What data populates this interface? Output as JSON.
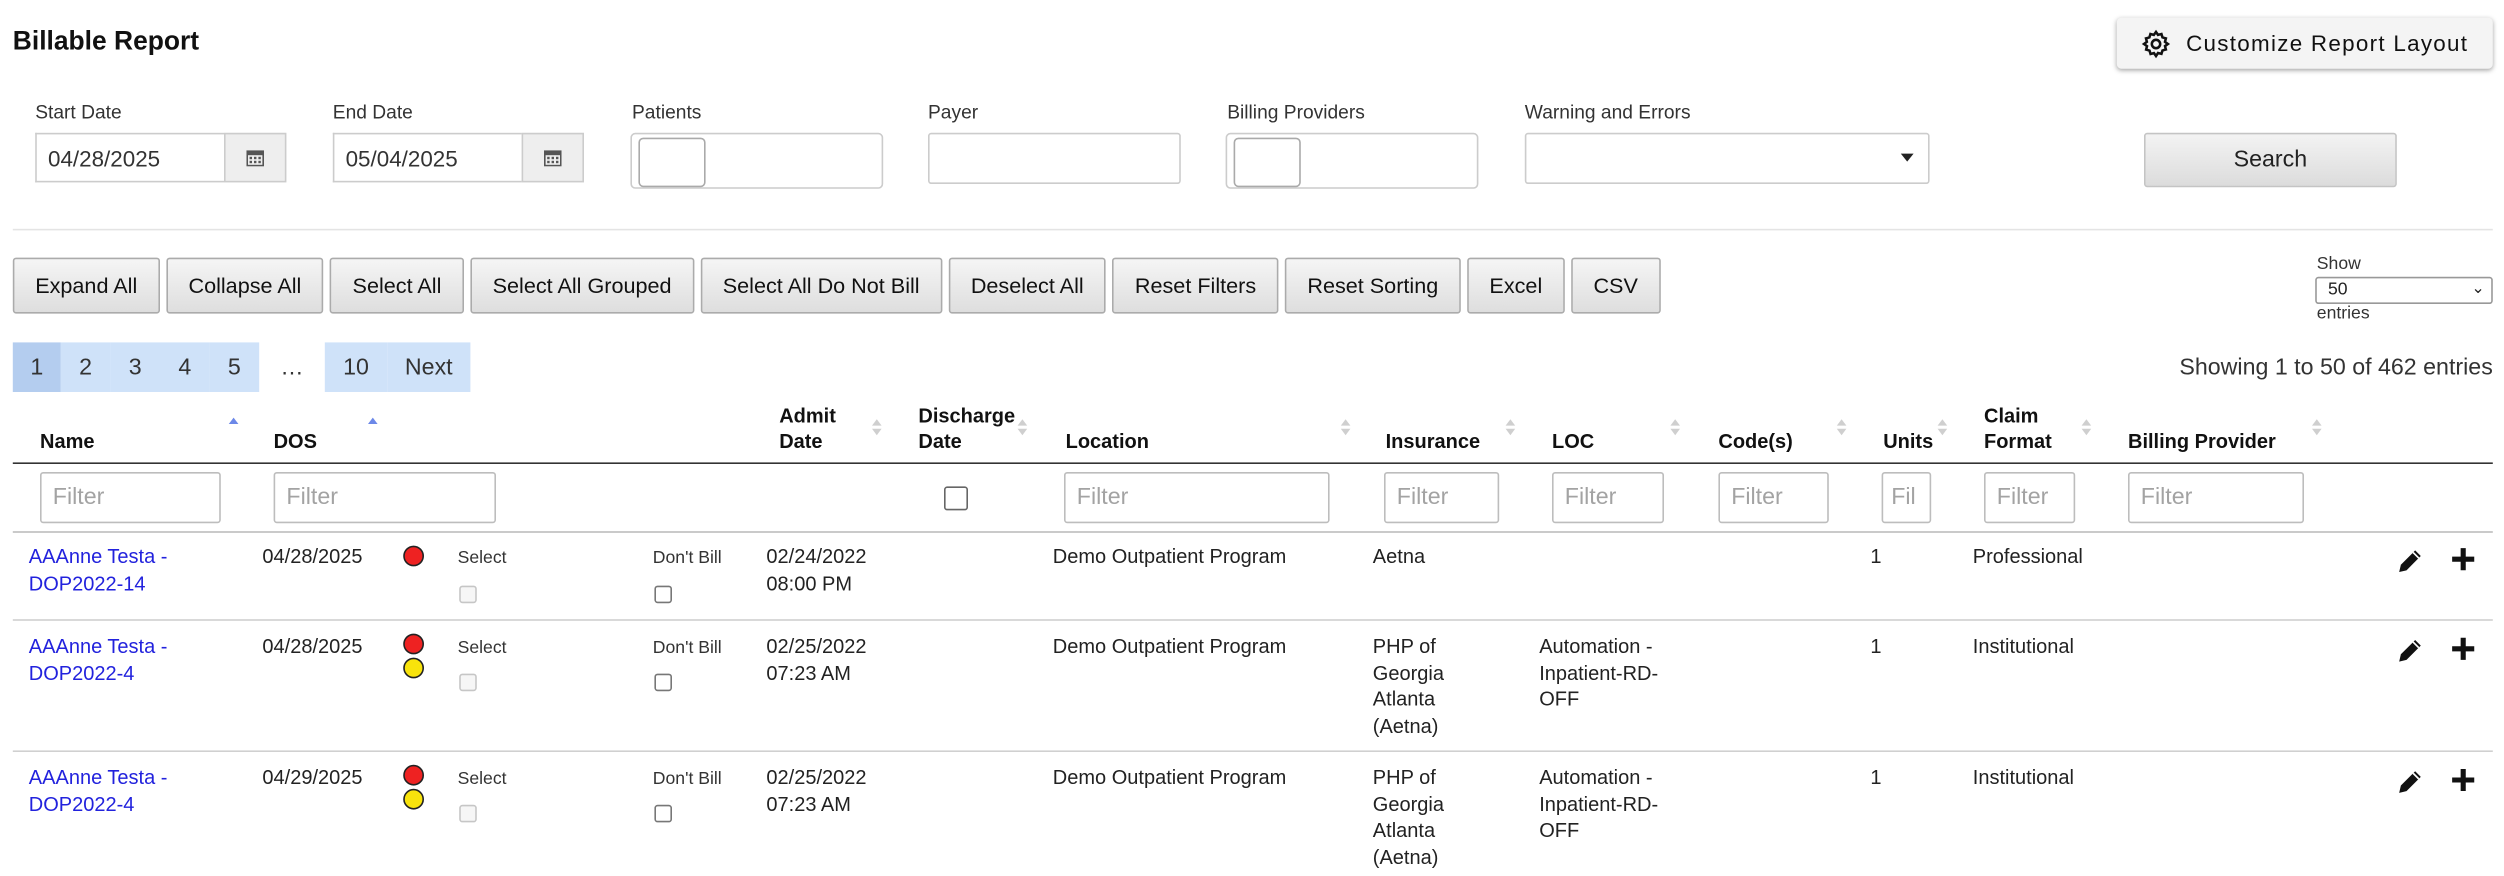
{
  "page": {
    "title": "Billable Report",
    "customize_label": "Customize Report Layout"
  },
  "filters": {
    "start_date": {
      "label": "Start Date",
      "value": "04/28/2025"
    },
    "end_date": {
      "label": "End Date",
      "value": "05/04/2025"
    },
    "patients": {
      "label": "Patients"
    },
    "payer": {
      "label": "Payer"
    },
    "billing_providers": {
      "label": "Billing Providers"
    },
    "warnings": {
      "label": "Warning and Errors"
    },
    "search_label": "Search"
  },
  "toolbar": {
    "expand_all": "Expand All",
    "collapse_all": "Collapse All",
    "select_all": "Select All",
    "select_all_grouped": "Select All Grouped",
    "select_all_dnb": "Select All Do Not Bill",
    "deselect_all": "Deselect All",
    "reset_filters": "Reset Filters",
    "reset_sorting": "Reset Sorting",
    "excel": "Excel",
    "csv": "CSV"
  },
  "page_length": {
    "show": "Show",
    "value": "50",
    "entries": "entries"
  },
  "pagination": {
    "pages": [
      "1",
      "2",
      "3",
      "4",
      "5"
    ],
    "ellipsis": "…",
    "last": "10",
    "next": "Next",
    "current": "1"
  },
  "showing": "Showing 1 to 50 of 462 entries",
  "columns": {
    "name": "Name",
    "dos": "DOS",
    "admit_1": "Admit",
    "admit_2": "Date",
    "discharge_1": "Discharge",
    "discharge_2": "Date",
    "location": "Location",
    "insurance": "Insurance",
    "loc": "LOC",
    "codes": "Code(s)",
    "units": "Units",
    "claim_1": "Claim",
    "claim_2": "Format",
    "billing_provider": "Billing Provider"
  },
  "filter_placeholder": "Filter",
  "filter_placeholder_short": "Fil",
  "row_labels": {
    "select": "Select",
    "dont_bill": "Don't Bill"
  },
  "rows": [
    {
      "name_1": "AAAnne Testa -",
      "name_2": "DOP2022-14",
      "dos": "04/28/2025",
      "status": [
        "red"
      ],
      "admit_1": "02/24/2022",
      "admit_2": "08:00 PM",
      "location": "Demo Outpatient Program",
      "insurance": [
        "Aetna"
      ],
      "loc": [],
      "units": "1",
      "claim_format": "Professional"
    },
    {
      "name_1": "AAAnne Testa -",
      "name_2": "DOP2022-4",
      "dos": "04/28/2025",
      "status": [
        "red",
        "yellow"
      ],
      "admit_1": "02/25/2022",
      "admit_2": "07:23 AM",
      "location": "Demo Outpatient Program",
      "insurance": [
        "PHP of",
        "Georgia",
        "Atlanta",
        "(Aetna)"
      ],
      "loc": [
        "Automation -",
        "Inpatient-RD-",
        "OFF"
      ],
      "units": "1",
      "claim_format": "Institutional"
    },
    {
      "name_1": "AAAnne Testa -",
      "name_2": "DOP2022-4",
      "dos": "04/29/2025",
      "status": [
        "red",
        "yellow"
      ],
      "admit_1": "02/25/2022",
      "admit_2": "07:23 AM",
      "location": "Demo Outpatient Program",
      "insurance": [
        "PHP of",
        "Georgia",
        "Atlanta",
        "(Aetna)"
      ],
      "loc": [
        "Automation -",
        "Inpatient-RD-",
        "OFF"
      ],
      "units": "1",
      "claim_format": "Institutional"
    }
  ]
}
